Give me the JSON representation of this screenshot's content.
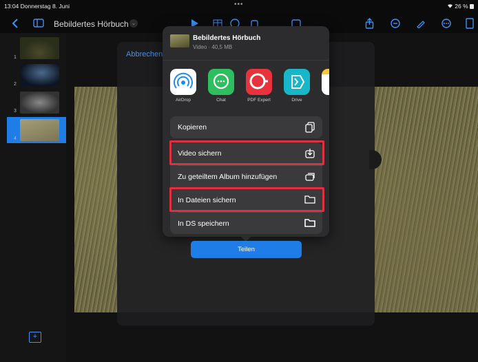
{
  "status": {
    "time": "13:04  Donnerstag 8. Juni",
    "dots": "•••",
    "battery": "26 %"
  },
  "toolbar": {
    "document_title": "Bebildertes Hörbuch"
  },
  "slides": [
    {
      "number": "1"
    },
    {
      "number": "2"
    },
    {
      "number": "3"
    },
    {
      "number": "4"
    }
  ],
  "editor": {
    "cancel_label": "Abbrechen"
  },
  "share_sheet": {
    "item_title": "Bebildertes Hörbuch",
    "item_subtitle": "Video · 40,5 MB",
    "apps": [
      {
        "label": "AirDrop",
        "icon": "airdrop-icon",
        "color": "#1a8ef5"
      },
      {
        "label": "Chat",
        "icon": "chat-icon",
        "color": "#2fbe5e"
      },
      {
        "label": "PDF Expert",
        "icon": "pdf-expert-icon",
        "color": "#e8323c"
      },
      {
        "label": "Drive",
        "icon": "drive-icon",
        "color": "#17b6c8"
      },
      {
        "label": "N",
        "icon": "notes-icon",
        "color": "#f6c93b"
      }
    ],
    "actions": [
      {
        "label": "Kopieren",
        "icon": "copy-icon"
      },
      {
        "label": "Video sichern",
        "icon": "save-video-icon"
      },
      {
        "label": "Zu geteiltem Album hinzufügen",
        "icon": "shared-album-icon"
      },
      {
        "label": "In Dateien sichern",
        "icon": "folder-icon"
      },
      {
        "label": "In DS speichern",
        "icon": "folder-icon"
      }
    ],
    "share_button": "Teilen"
  },
  "colors": {
    "accent": "#3b93f7",
    "highlight": "#e0303f"
  }
}
